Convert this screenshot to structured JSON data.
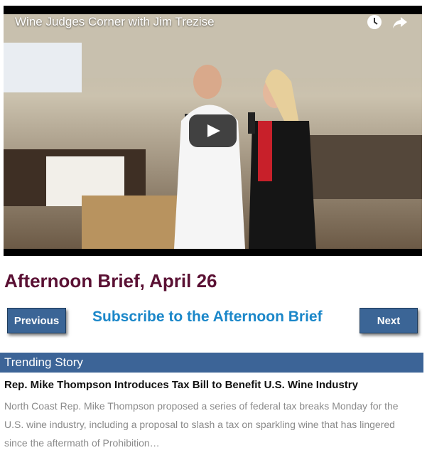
{
  "video": {
    "title": "Wine Judges Corner with Jim Trezise",
    "icons": [
      "clock-icon",
      "share-icon",
      "play-icon"
    ]
  },
  "headline": "Afternoon Brief, April 26",
  "nav": {
    "previous_label": "Previous",
    "subscribe_label": "Subscribe to the Afternoon Brief",
    "next_label": "Next"
  },
  "trending": {
    "label": "Trending Story",
    "story_title": "Rep. Mike Thompson Introduces Tax Bill to Benefit U.S. Wine Industry",
    "story_summary": "North Coast Rep. Mike Thompson proposed a series of federal tax breaks Monday for the U.S. wine industry, including a proposal to slash a tax on sparkling wine that has lingered since the aftermath of Prohibition…"
  },
  "colors": {
    "headline": "#5a1033",
    "link": "#1b87c9",
    "button": "#3b6596",
    "trend_bar": "#3c6497"
  }
}
